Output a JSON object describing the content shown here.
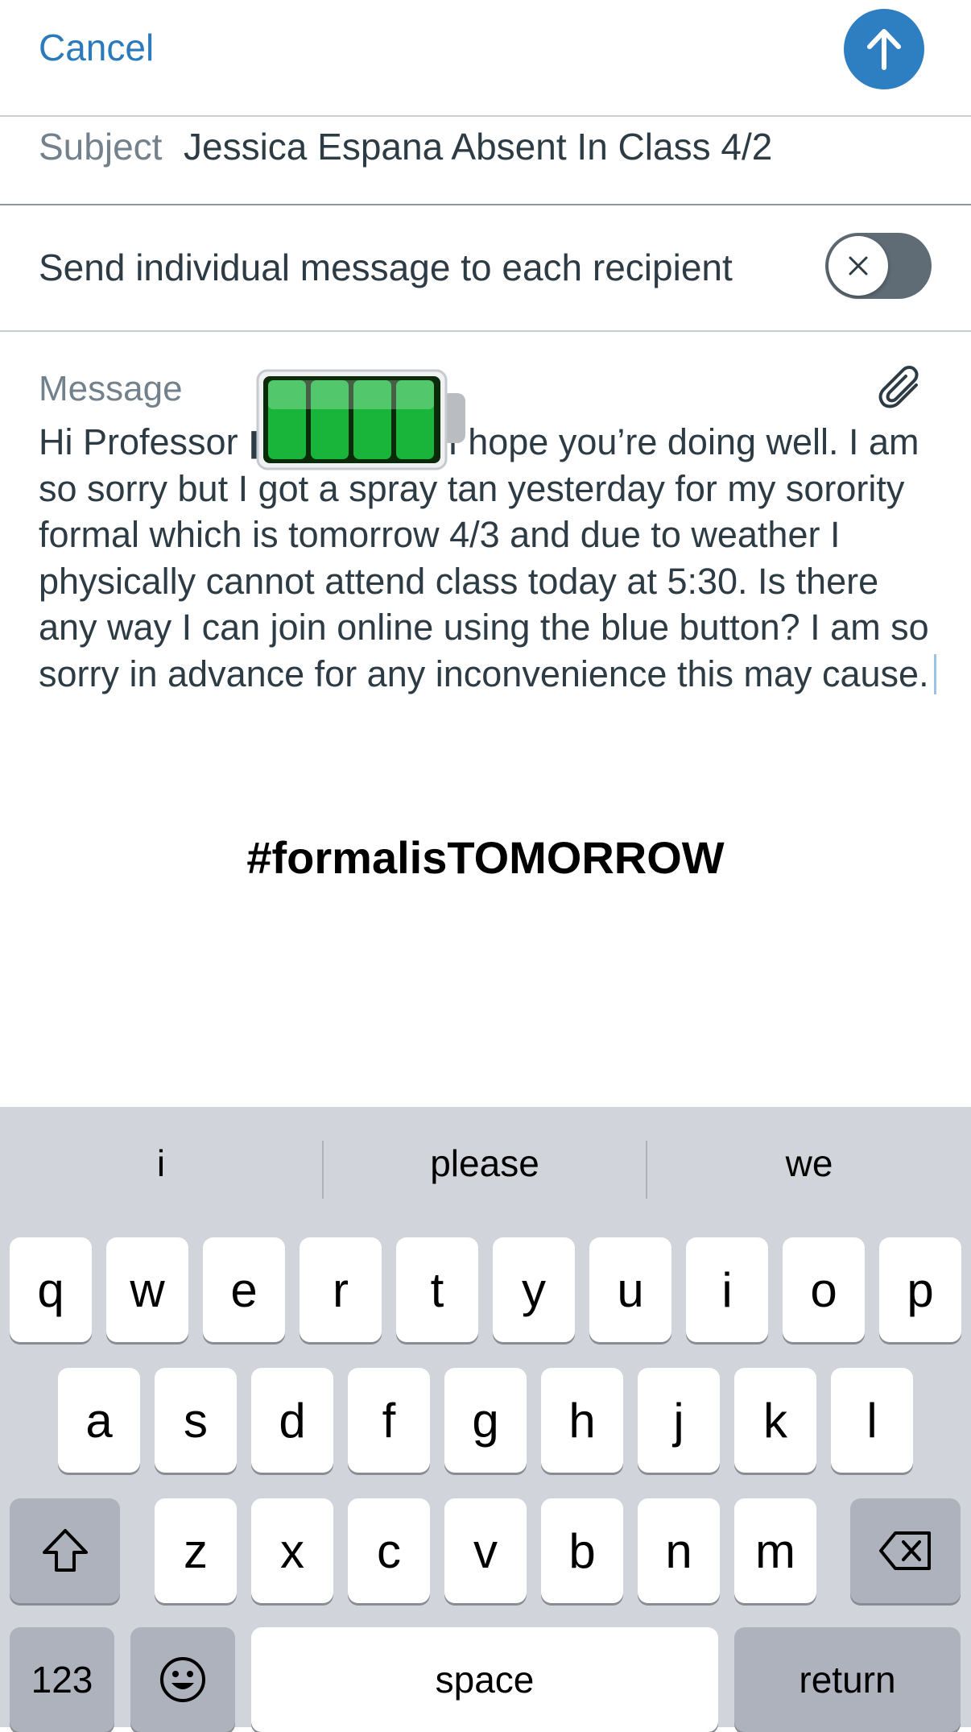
{
  "header": {
    "cancel_label": "Cancel",
    "send_icon": "arrow-up-icon",
    "accent_color": "#2d7fc1"
  },
  "subject": {
    "label": "Subject",
    "value": "Jessica Espana Absent In Class 4/2"
  },
  "individual": {
    "label": "Send individual message to each recipient",
    "enabled": false,
    "knob_icon": "close-icon"
  },
  "message": {
    "label": "Message",
    "body": "Hi Professor ▮▮▮▮▮▮▮▮e! I hope you’re doing well. I am so sorry but I got a spray tan yesterday for my sorority formal which is tomorrow 4/3 and due to weather I physically cannot attend class today at 5:30. Is there any way I can join online using the blue button? I am so sorry in advance for any inconvenience this may cause.",
    "attach_icon": "paperclip-icon",
    "overlay_icon": "battery-icon"
  },
  "overlay_text": "#formalisTOMORROW",
  "keyboard": {
    "suggestions": [
      "i",
      "please",
      "we"
    ],
    "row1": [
      "q",
      "w",
      "e",
      "r",
      "t",
      "y",
      "u",
      "i",
      "o",
      "p"
    ],
    "row2": [
      "a",
      "s",
      "d",
      "f",
      "g",
      "h",
      "j",
      "k",
      "l"
    ],
    "row3": [
      "z",
      "x",
      "c",
      "v",
      "b",
      "n",
      "m"
    ],
    "numbers_label": "123",
    "space_label": "space",
    "return_label": "return",
    "shift_icon": "shift-icon",
    "delete_icon": "delete-icon",
    "emoji_icon": "emoji-icon"
  }
}
